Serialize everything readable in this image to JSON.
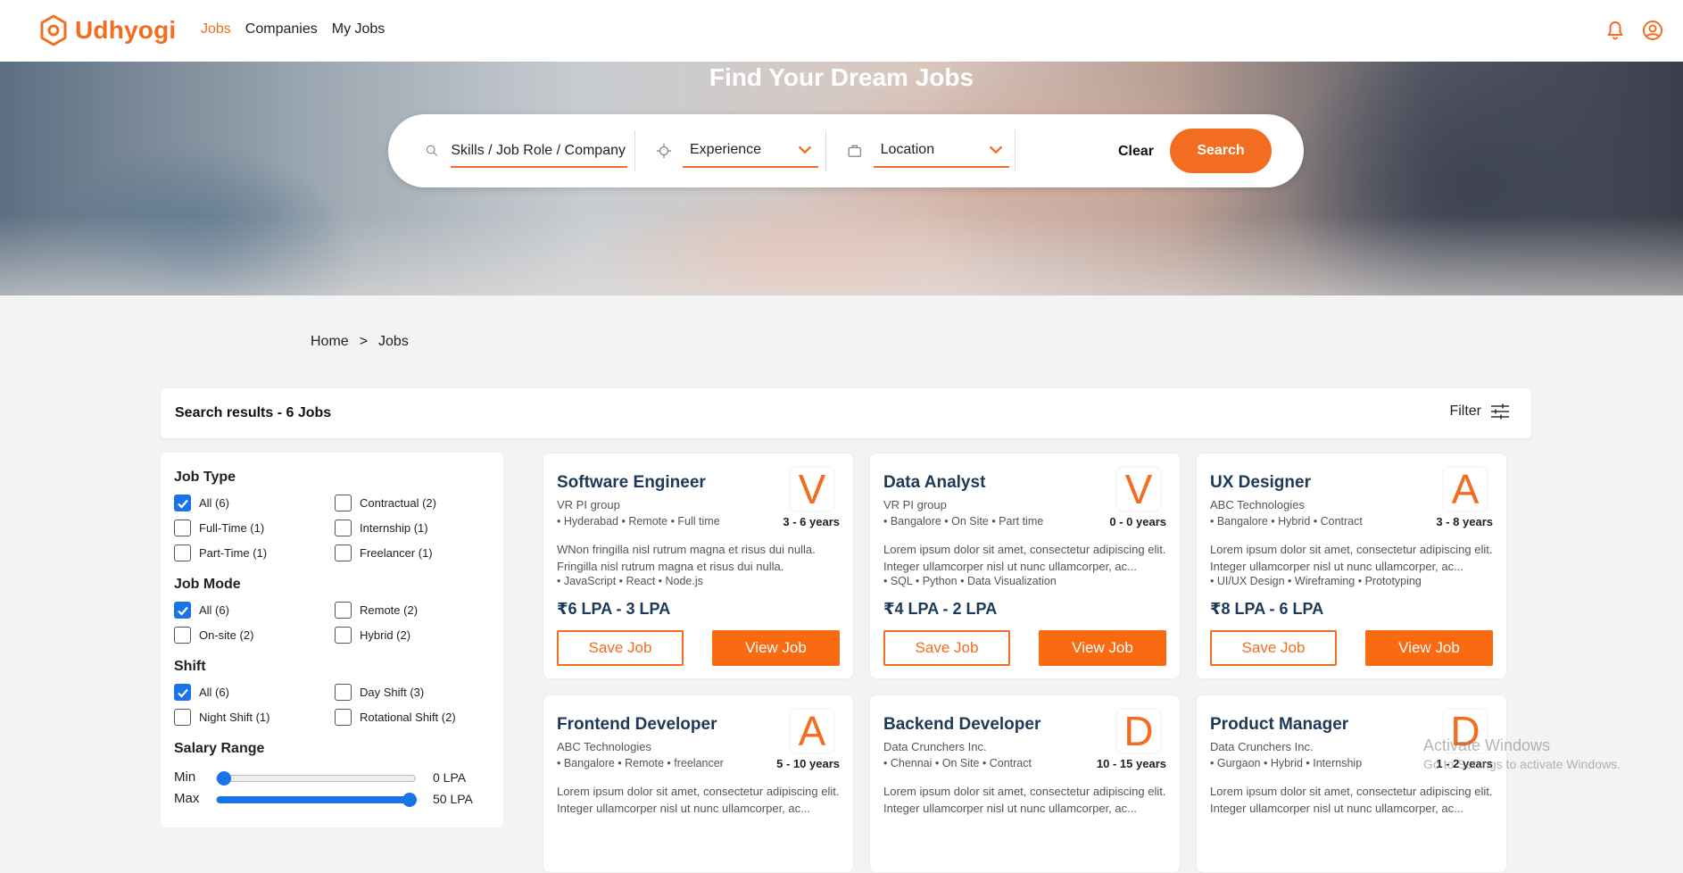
{
  "brand": {
    "name": "Udhyogi",
    "color": "#f26d1f",
    "logo_icon": "hexagon-ring-icon"
  },
  "nav": {
    "items": [
      {
        "label": "Jobs",
        "active": true
      },
      {
        "label": "Companies",
        "active": false
      },
      {
        "label": "My Jobs",
        "active": false
      }
    ]
  },
  "header_icons": {
    "notifications": "bell-icon",
    "profile": "user-circle-icon"
  },
  "hero": {
    "title": "Find Your Dream Jobs"
  },
  "search": {
    "keyword_placeholder": "Skills / Job Role / Company",
    "experience_label": "Experience",
    "location_label": "Location",
    "clear_label": "Clear",
    "search_label": "Search"
  },
  "breadcrumb": {
    "home": "Home",
    "separator": ">",
    "current": "Jobs"
  },
  "results": {
    "summary": "Search results - 6 Jobs",
    "filter_label": "Filter"
  },
  "filters": {
    "job_type": {
      "title": "Job Type",
      "options": [
        {
          "label": "All (6)",
          "checked": true
        },
        {
          "label": "Contractual (2)",
          "checked": false
        },
        {
          "label": "Full-Time (1)",
          "checked": false
        },
        {
          "label": "Internship (1)",
          "checked": false
        },
        {
          "label": "Part-Time (1)",
          "checked": false
        },
        {
          "label": "Freelancer (1)",
          "checked": false
        }
      ]
    },
    "job_mode": {
      "title": "Job Mode",
      "options": [
        {
          "label": "All (6)",
          "checked": true
        },
        {
          "label": "Remote (2)",
          "checked": false
        },
        {
          "label": "On-site (2)",
          "checked": false
        },
        {
          "label": "Hybrid (2)",
          "checked": false
        }
      ]
    },
    "shift": {
      "title": "Shift",
      "options": [
        {
          "label": "All (6)",
          "checked": true
        },
        {
          "label": "Day Shift (3)",
          "checked": false
        },
        {
          "label": "Night Shift (1)",
          "checked": false
        },
        {
          "label": "Rotational Shift (2)",
          "checked": false
        }
      ]
    },
    "salary": {
      "title": "Salary Range",
      "min_label": "Min",
      "max_label": "Max",
      "min_value": "0 LPA",
      "max_value": "50 LPA",
      "min_fraction": 0.0,
      "max_fraction": 1.0
    }
  },
  "jobs": [
    {
      "title": "Software Engineer",
      "company": "VR PI group",
      "letter": "V",
      "meta": "• Hyderabad • Remote • Full time",
      "experience": "3 - 6 years",
      "desc": "WNon fringilla nisl rutrum magna et risus dui nulla. Fringilla nisl rutrum magna et risus dui nulla.",
      "skills": "• JavaScript • React • Node.js",
      "salary": "₹6 LPA - 3 LPA",
      "save": "Save Job",
      "view": "View Job"
    },
    {
      "title": "Data Analyst",
      "company": "VR PI group",
      "letter": "V",
      "meta": "• Bangalore • On Site • Part time",
      "experience": "0 - 0 years",
      "desc": "Lorem ipsum dolor sit amet, consectetur adipiscing elit. Integer ullamcorper nisl ut nunc ullamcorper, ac...",
      "skills": "• SQL • Python • Data Visualization",
      "salary": "₹4 LPA - 2 LPA",
      "save": "Save Job",
      "view": "View Job"
    },
    {
      "title": "UX Designer",
      "company": "ABC Technologies",
      "letter": "A",
      "meta": "• Bangalore • Hybrid • Contract",
      "experience": "3 - 8 years",
      "desc": "Lorem ipsum dolor sit amet, consectetur adipiscing elit. Integer ullamcorper nisl ut nunc ullamcorper, ac...",
      "skills": "• UI/UX Design • Wireframing • Prototyping",
      "salary": "₹8 LPA - 6 LPA",
      "save": "Save Job",
      "view": "View Job"
    },
    {
      "title": "Frontend Developer",
      "company": "ABC Technologies",
      "letter": "A",
      "meta": "• Bangalore • Remote • freelancer",
      "experience": "5 - 10 years",
      "desc": "Lorem ipsum dolor sit amet, consectetur adipiscing elit. Integer ullamcorper nisl ut nunc ullamcorper, ac...",
      "skills": "",
      "salary": "",
      "save": "",
      "view": ""
    },
    {
      "title": "Backend Developer",
      "company": "Data Crunchers Inc.",
      "letter": "D",
      "meta": "• Chennai • On Site • Contract",
      "experience": "10 - 15 years",
      "desc": "Lorem ipsum dolor sit amet, consectetur adipiscing elit. Integer ullamcorper nisl ut nunc ullamcorper, ac...",
      "skills": "",
      "salary": "",
      "save": "",
      "view": ""
    },
    {
      "title": "Product Manager",
      "company": "Data Crunchers Inc.",
      "letter": "D",
      "meta": "• Gurgaon • Hybrid • Internship",
      "experience": "1 - 2 years",
      "desc": "Lorem ipsum dolor sit amet, consectetur adipiscing elit. Integer ullamcorper nisl ut nunc ullamcorper, ac...",
      "skills": "",
      "salary": "",
      "save": "",
      "view": ""
    }
  ],
  "watermark": {
    "line1": "Activate Windows",
    "line2": "Go to Settings to activate Windows."
  },
  "colors": {
    "accent": "#f26d1f",
    "button": "#fa6a10",
    "title": "#1c3a57",
    "checkbox": "#1a73e8"
  }
}
